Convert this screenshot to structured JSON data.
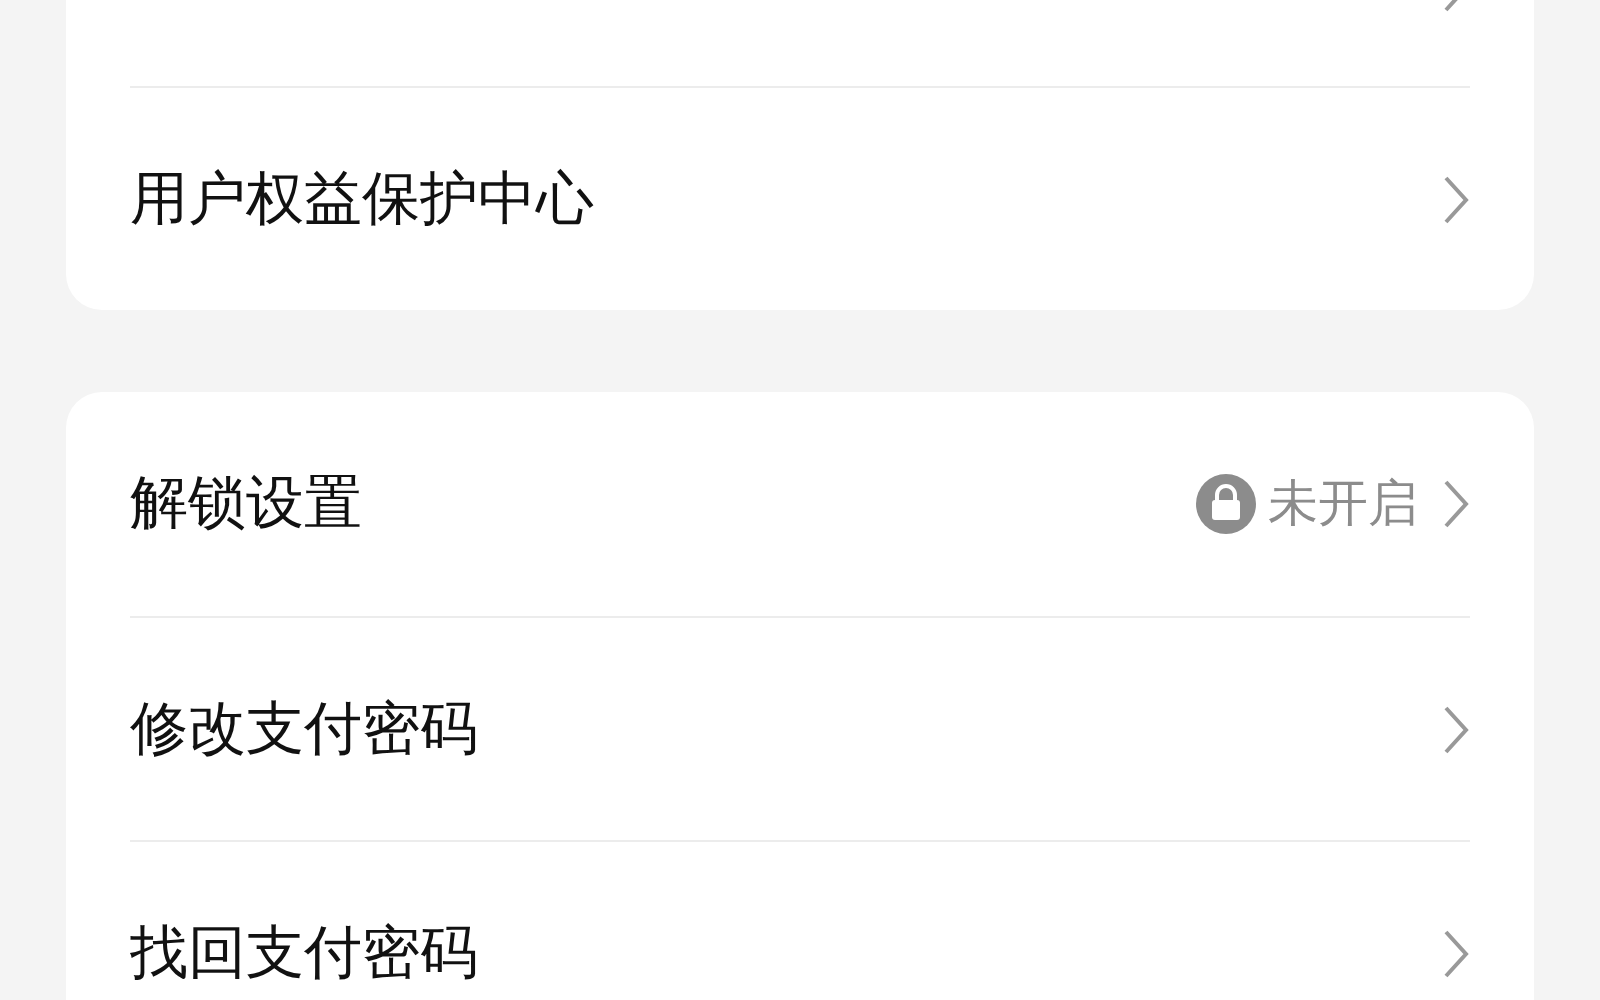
{
  "groups": [
    {
      "items": [
        {
          "kind": "link"
        },
        {
          "kind": "link",
          "label": "用户权益保护中心"
        }
      ]
    },
    {
      "items": [
        {
          "kind": "link",
          "label": "解锁设置",
          "status": "未开启"
        },
        {
          "kind": "link",
          "label": "修改支付密码"
        },
        {
          "kind": "link",
          "label": "找回支付密码"
        }
      ]
    }
  ]
}
